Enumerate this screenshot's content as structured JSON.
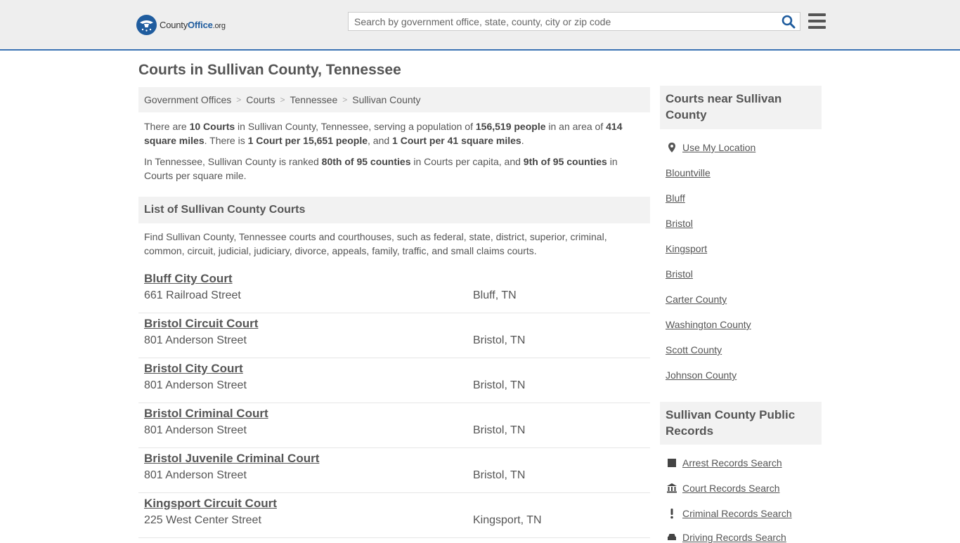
{
  "header": {
    "logo_county": "County",
    "logo_office": "Office",
    "logo_org": ".org",
    "search_placeholder": "Search by government office, state, county, city or zip code"
  },
  "page": {
    "title": "Courts in Sullivan County, Tennessee",
    "breadcrumb": [
      "Government Offices",
      "Courts",
      "Tennessee",
      "Sullivan County"
    ],
    "intro1": {
      "t1": "There are ",
      "b1": "10 Courts",
      "t2": " in Sullivan County, Tennessee, serving a population of ",
      "b2": "156,519 people",
      "t3": " in an area of ",
      "b3": "414 square miles",
      "t4": ". There is ",
      "b4": "1 Court per 15,651 people",
      "t5": ", and ",
      "b5": "1 Court per 41 square miles",
      "t6": "."
    },
    "intro2": {
      "t1": "In Tennessee, Sullivan County is ranked ",
      "b1": "80th of 95 counties",
      "t2": " in Courts per capita, and ",
      "b2": "9th of 95 counties",
      "t3": " in Courts per square mile."
    },
    "list_heading": "List of Sullivan County Courts",
    "list_desc": "Find Sullivan County, Tennessee courts and courthouses, such as federal, state, district, superior, criminal, common, circuit, judicial, judiciary, divorce, appeals, family, traffic, and small claims courts.",
    "courts": [
      {
        "name": "Bluff City Court",
        "address": "661 Railroad Street",
        "city": "Bluff, TN"
      },
      {
        "name": "Bristol Circuit Court",
        "address": "801 Anderson Street",
        "city": "Bristol, TN"
      },
      {
        "name": "Bristol City Court",
        "address": "801 Anderson Street",
        "city": "Bristol, TN"
      },
      {
        "name": "Bristol Criminal Court",
        "address": "801 Anderson Street",
        "city": "Bristol, TN"
      },
      {
        "name": "Bristol Juvenile Criminal Court",
        "address": "801 Anderson Street",
        "city": "Bristol, TN"
      },
      {
        "name": "Kingsport Circuit Court",
        "address": "225 West Center Street",
        "city": "Kingsport, TN"
      }
    ]
  },
  "sidebar": {
    "near_heading": "Courts near Sullivan County",
    "use_location": "Use My Location",
    "near_links": [
      "Blountville",
      "Bluff",
      "Bristol",
      "Kingsport",
      "Bristol",
      "Carter County",
      "Washington County",
      "Scott County",
      "Johnson County"
    ],
    "records_heading": "Sullivan County Public Records",
    "records_links": [
      {
        "label": "Arrest Records Search",
        "icon": "square-icon"
      },
      {
        "label": "Court Records Search",
        "icon": "courthouse-icon"
      },
      {
        "label": "Criminal Records Search",
        "icon": "exclamation-icon"
      },
      {
        "label": "Driving Records Search",
        "icon": "car-icon"
      }
    ]
  },
  "colors": {
    "brand": "#1f5c9e",
    "header_border": "#3c73b4"
  }
}
